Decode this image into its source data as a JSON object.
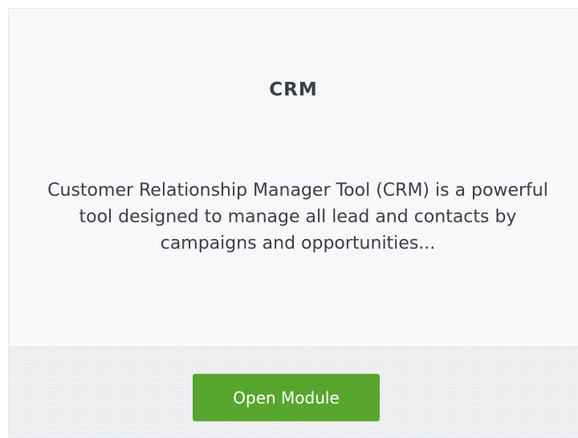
{
  "module": {
    "logo_text": "CRM",
    "description": "Customer Relationship Manager Tool (CRM) is a powerful tool designed to manage all lead and contacts by campaigns and opportunities...",
    "button_label": "Open Module",
    "accent_color": "#58a62e"
  }
}
